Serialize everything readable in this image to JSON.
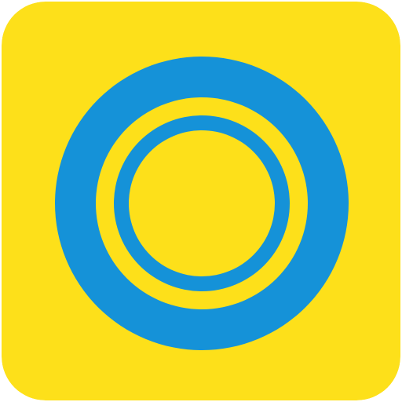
{
  "app_icon": {
    "icon": "concentric-rings-icon",
    "colors": {
      "background": "#FDE01A",
      "ring": "#1592D8"
    }
  }
}
